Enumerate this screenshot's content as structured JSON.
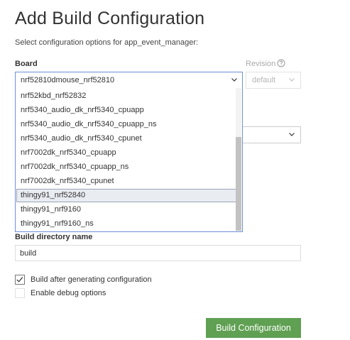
{
  "page": {
    "title": "Add Build Configuration",
    "subtitle": "Select configuration options for app_event_manager:"
  },
  "board": {
    "label": "Board",
    "selected": "nrf52810dmouse_nrf52810",
    "options": [
      "nrf52kbd_nrf52832",
      "nrf5340_audio_dk_nrf5340_cpuapp",
      "nrf5340_audio_dk_nrf5340_cpuapp_ns",
      "nrf5340_audio_dk_nrf5340_cpunet",
      "nrf7002dk_nrf5340_cpuapp",
      "nrf7002dk_nrf5340_cpuapp_ns",
      "nrf7002dk_nrf5340_cpunet",
      "thingy91_nrf52840",
      "thingy91_nrf9160",
      "thingy91_nrf9160_ns"
    ],
    "highlighted": "thingy91_nrf52840",
    "scroll_position_fraction": 0.35
  },
  "revision": {
    "label": "Revision",
    "value": "default",
    "icon": "help-circle-icon"
  },
  "build_directory": {
    "label": "Build directory name",
    "value": "build"
  },
  "options": {
    "build_after": {
      "label": "Build after generating configuration",
      "checked": true
    },
    "debug": {
      "label": "Enable debug options",
      "checked": false
    }
  },
  "actions": {
    "build_button": "Build Configuration"
  },
  "colors": {
    "accent_border": "#6d8fd9",
    "primary_button": "#5fa052",
    "highlight_row": "#e9ecf1"
  }
}
